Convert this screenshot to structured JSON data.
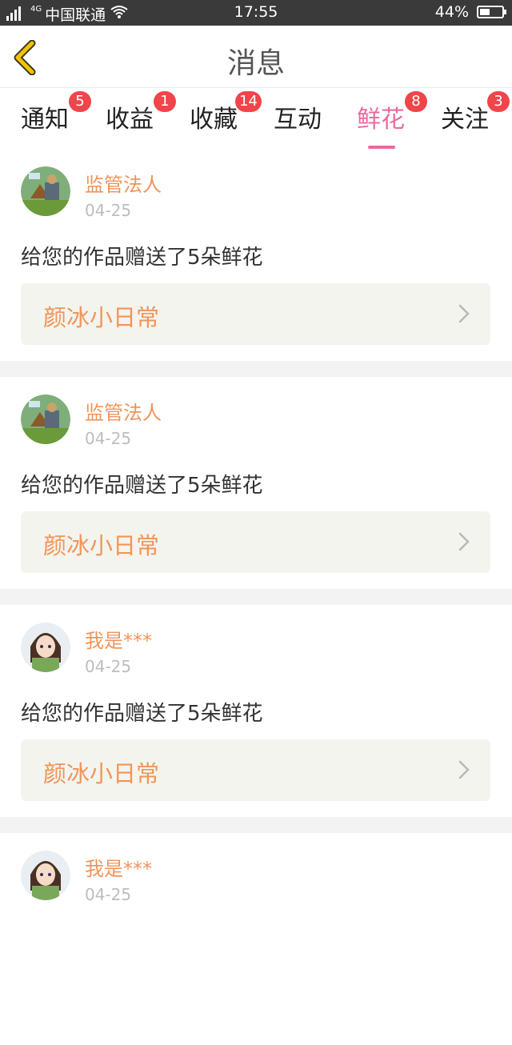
{
  "status_bar": {
    "network": "4G",
    "carrier": "中国联通",
    "time": "17:55",
    "battery": "44%",
    "battery_level": 0.44
  },
  "header": {
    "title": "消息",
    "back_icon": "chevron-left-icon"
  },
  "tabs": [
    {
      "label": "通知",
      "badge": "5"
    },
    {
      "label": "收益",
      "badge": "1"
    },
    {
      "label": "收藏",
      "badge": "14"
    },
    {
      "label": "互动",
      "badge": ""
    },
    {
      "label": "鲜花",
      "badge": "8",
      "active": true
    },
    {
      "label": "关注",
      "badge": "3"
    }
  ],
  "items": [
    {
      "name": "监管法人",
      "date": "04-25",
      "message": "给您的作品赠送了5朵鲜花",
      "work": "颜冰小日常"
    },
    {
      "name": "监管法人",
      "date": "04-25",
      "message": "给您的作品赠送了5朵鲜花",
      "work": "颜冰小日常"
    },
    {
      "name": "我是***",
      "date": "04-25",
      "message": "给您的作品赠送了5朵鲜花",
      "work": "颜冰小日常"
    },
    {
      "name": "我是***",
      "date": "04-25",
      "message": "",
      "work": ""
    }
  ],
  "colors": {
    "accent_pink": "#ea6aa0",
    "name_orange": "#f0955a",
    "badge_red": "#f0454a",
    "back_yellow": "#f2c400"
  }
}
